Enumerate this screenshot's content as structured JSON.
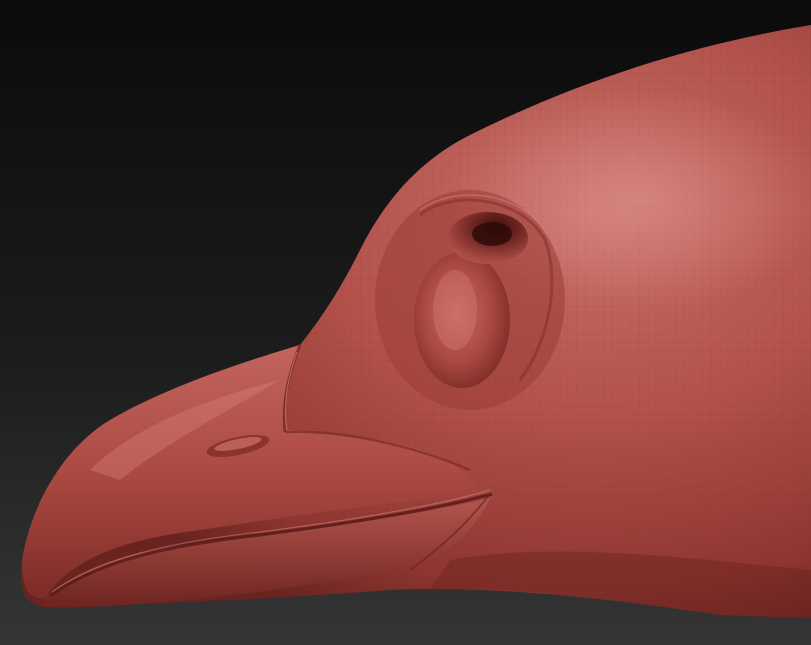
{
  "scene": {
    "subject": "bird-head-sculpt",
    "colors": {
      "bg_top": "#0d0d0d",
      "bg_bottom": "#2e2e2e",
      "clay_light": "#c4655c",
      "clay_mid": "#a8463f",
      "clay_dark": "#6e2620",
      "clay_shadow": "#3a0f0c",
      "wire": "#7a2e28"
    }
  }
}
